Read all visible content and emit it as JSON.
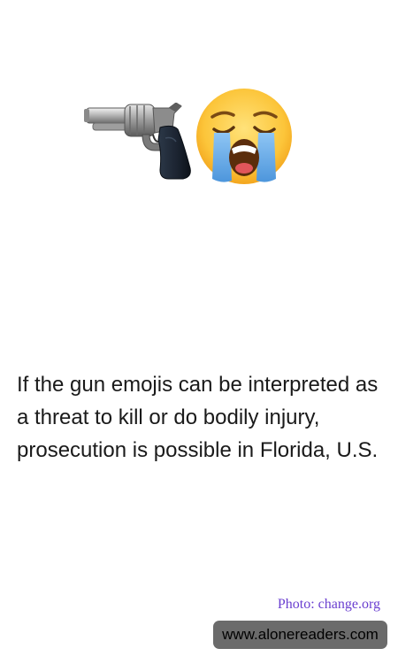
{
  "illustration": {
    "icons": [
      "pistol-icon",
      "loudly-crying-face-icon"
    ]
  },
  "body_text": "If the gun emojis can be interpreted as a threat to kill or do bodily injury, prosecution is possible in Florida, U.S.",
  "photo_credit": "Photo: change.org",
  "site_badge": "www.alonereaders.com",
  "colors": {
    "credit_text": "#6a3fd0",
    "badge_background": "#6b6b6b",
    "body_text": "#1a1a1a"
  }
}
